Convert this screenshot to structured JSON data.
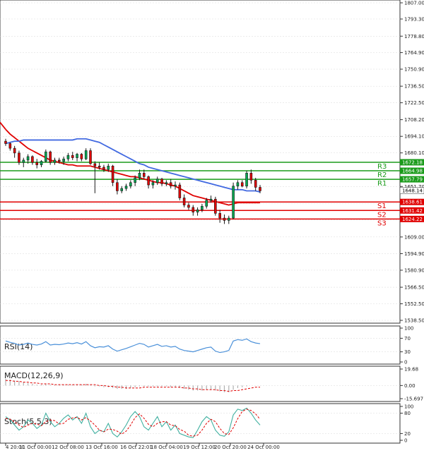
{
  "colors": {
    "background": "#ffffff",
    "grid": "#d9d9d9",
    "axis": "#333333",
    "candle": "#1a1a1a",
    "bull": "#00a651",
    "bear": "#e00000",
    "ma_fast": "#e00000",
    "ma_slow": "#4169e1",
    "resistance": "#1a9b1a",
    "support": "#e00000",
    "rsi_line": "#4a90d9",
    "macd_hist": "#b0b0b0",
    "macd_signal": "#e00000",
    "stoch_main": "#40b0a0",
    "stoch_signal": "#e00000"
  },
  "price_axis": {
    "ticks": [
      "1807.00",
      "1793.30",
      "1778.80",
      "1764.90",
      "1750.90",
      "1736.50",
      "1722.50",
      "1708.20",
      "1694.10",
      "1680.10",
      "1651.70",
      "1637.40",
      "1623.30",
      "1609.00",
      "1594.90",
      "1580.90",
      "1566.50",
      "1552.50",
      "1538.50"
    ]
  },
  "level_tags": [
    {
      "label": "R3",
      "value": "1672.18",
      "kind": "resistance"
    },
    {
      "label": "R2",
      "value": "1664.98",
      "kind": "resistance"
    },
    {
      "label": "R1",
      "value": "1657.79",
      "kind": "resistance"
    },
    {
      "label": "",
      "value": "1648.14",
      "kind": "current"
    },
    {
      "label": "S1",
      "value": "1638.61",
      "kind": "support"
    },
    {
      "label": "S2",
      "value": "1631.42",
      "kind": "support"
    },
    {
      "label": "S3",
      "value": "1624.22",
      "kind": "support"
    }
  ],
  "time_axis": {
    "labels": [
      "4 20:00",
      "11 Oct 00:00",
      "12 Oct 08:00",
      "13 Oct 16:00",
      "16 Oct 22:01",
      "18 Oct 04:00",
      "19 Oct 12:00",
      "20 Oct 20:00",
      "24 Oct 00:00"
    ]
  },
  "indicators": {
    "rsi": {
      "title": "RSI(14)",
      "ticks": [
        "100",
        "70",
        "30",
        "0"
      ]
    },
    "macd": {
      "title": "MACD(12,26,9)",
      "ticks": [
        "19.68",
        "0.00",
        "-15.697"
      ]
    },
    "stoch": {
      "title": "Stoch(5,5,3)",
      "ticks": [
        "100",
        "80",
        "20",
        "0"
      ]
    }
  },
  "chart_data": {
    "type": "candlestick",
    "y_range": [
      1538.5,
      1807.0
    ],
    "candles": [
      [
        1690,
        1692,
        1686,
        1688
      ],
      [
        1688,
        1689,
        1682,
        1684
      ],
      [
        1684,
        1686,
        1676,
        1680
      ],
      [
        1680,
        1682,
        1670,
        1672
      ],
      [
        1672,
        1676,
        1668,
        1674
      ],
      [
        1674,
        1679,
        1671,
        1677
      ],
      [
        1677,
        1678,
        1670,
        1672
      ],
      [
        1672,
        1675,
        1667,
        1670
      ],
      [
        1670,
        1674,
        1668,
        1673
      ],
      [
        1673,
        1683,
        1672,
        1681
      ],
      [
        1681,
        1682,
        1670,
        1672
      ],
      [
        1672,
        1676,
        1670,
        1674
      ],
      [
        1674,
        1676,
        1671,
        1673
      ],
      [
        1673,
        1677,
        1670,
        1675
      ],
      [
        1675,
        1680,
        1673,
        1678
      ],
      [
        1678,
        1681,
        1674,
        1676
      ],
      [
        1676,
        1680,
        1673,
        1679
      ],
      [
        1679,
        1680,
        1673,
        1675
      ],
      [
        1675,
        1684,
        1674,
        1682
      ],
      [
        1682,
        1684,
        1670,
        1671
      ],
      [
        1671,
        1673,
        1646,
        1669
      ],
      [
        1669,
        1672,
        1666,
        1668
      ],
      [
        1668,
        1670,
        1664,
        1666
      ],
      [
        1666,
        1671,
        1664,
        1669
      ],
      [
        1669,
        1670,
        1652,
        1655
      ],
      [
        1655,
        1658,
        1645,
        1648
      ],
      [
        1648,
        1652,
        1646,
        1650
      ],
      [
        1650,
        1654,
        1648,
        1652
      ],
      [
        1652,
        1657,
        1650,
        1655
      ],
      [
        1655,
        1661,
        1652,
        1659
      ],
      [
        1659,
        1666,
        1657,
        1663
      ],
      [
        1663,
        1666,
        1658,
        1660
      ],
      [
        1660,
        1661,
        1650,
        1653
      ],
      [
        1653,
        1657,
        1650,
        1655
      ],
      [
        1655,
        1660,
        1653,
        1658
      ],
      [
        1658,
        1659,
        1652,
        1654
      ],
      [
        1654,
        1657,
        1652,
        1655
      ],
      [
        1655,
        1658,
        1650,
        1652
      ],
      [
        1652,
        1656,
        1649,
        1653
      ],
      [
        1653,
        1655,
        1640,
        1642
      ],
      [
        1642,
        1645,
        1634,
        1636
      ],
      [
        1636,
        1638,
        1632,
        1634
      ],
      [
        1634,
        1636,
        1627,
        1630
      ],
      [
        1630,
        1634,
        1627,
        1632
      ],
      [
        1632,
        1637,
        1630,
        1635
      ],
      [
        1635,
        1642,
        1633,
        1640
      ],
      [
        1640,
        1644,
        1638,
        1641
      ],
      [
        1641,
        1643,
        1627,
        1629
      ],
      [
        1629,
        1632,
        1621,
        1625
      ],
      [
        1625,
        1628,
        1620,
        1623
      ],
      [
        1623,
        1627,
        1620,
        1625
      ],
      [
        1625,
        1655,
        1624,
        1652
      ],
      [
        1652,
        1657,
        1649,
        1655
      ],
      [
        1655,
        1657,
        1651,
        1652
      ],
      [
        1652,
        1665,
        1650,
        1663
      ],
      [
        1663,
        1666,
        1654,
        1657
      ],
      [
        1657,
        1659,
        1648,
        1651
      ],
      [
        1651,
        1653,
        1646,
        1648
      ]
    ],
    "ma_fast": [
      1700,
      1696,
      1693,
      1690,
      1687,
      1684,
      1682,
      1680,
      1678,
      1676,
      1674,
      1673,
      1672,
      1671,
      1670,
      1670,
      1669,
      1669,
      1669,
      1669,
      1668,
      1667,
      1666,
      1665,
      1664,
      1663,
      1662,
      1661,
      1660,
      1660,
      1659,
      1658,
      1657,
      1656,
      1655,
      1655,
      1654,
      1653,
      1652,
      1650,
      1648,
      1646,
      1644,
      1643,
      1642,
      1641,
      1640,
      1639,
      1638,
      1637,
      1636,
      1637,
      1638,
      1638,
      1638,
      1638,
      1638,
      1638
    ],
    "ma_slow": [
      1688,
      1689,
      1690,
      1690,
      1691,
      1691,
      1691,
      1691,
      1691,
      1691,
      1691,
      1691,
      1691,
      1691,
      1691,
      1691,
      1692,
      1692,
      1692,
      1691,
      1690,
      1689,
      1687,
      1685,
      1683,
      1681,
      1679,
      1677,
      1675,
      1673,
      1671,
      1670,
      1668,
      1667,
      1666,
      1665,
      1664,
      1663,
      1662,
      1661,
      1660,
      1659,
      1658,
      1657,
      1656,
      1655,
      1654,
      1653,
      1652,
      1651,
      1650,
      1649,
      1649,
      1649,
      1648,
      1648,
      1648,
      1647
    ],
    "rsi": [
      62,
      58,
      55,
      50,
      52,
      56,
      52,
      50,
      53,
      60,
      50,
      52,
      51,
      53,
      56,
      54,
      57,
      53,
      60,
      48,
      42,
      45,
      44,
      48,
      38,
      32,
      36,
      40,
      45,
      50,
      55,
      52,
      44,
      48,
      52,
      46,
      48,
      44,
      46,
      38,
      34,
      32,
      30,
      34,
      38,
      42,
      44,
      32,
      28,
      30,
      34,
      62,
      66,
      64,
      68,
      60,
      56,
      54
    ],
    "macd": [
      8,
      7,
      6,
      5,
      4,
      3,
      2,
      1,
      1,
      2,
      1,
      1,
      1,
      1,
      1,
      1,
      1,
      1,
      2,
      1,
      -1,
      -1,
      -2,
      -2,
      -3,
      -4,
      -4,
      -4,
      -3,
      -2,
      -1,
      -1,
      -1,
      -1,
      -1,
      -1,
      -1,
      -2,
      -2,
      -3,
      -4,
      -5,
      -6,
      -6,
      -6,
      -5,
      -5,
      -6,
      -7,
      -8,
      -8,
      -5,
      -3,
      -2,
      -1,
      0,
      0,
      0
    ],
    "macd_signal": [
      6,
      6,
      5,
      5,
      4,
      4,
      3,
      3,
      2,
      2,
      2,
      1,
      1,
      1,
      1,
      1,
      1,
      1,
      1,
      1,
      1,
      0,
      0,
      -1,
      -1,
      -2,
      -2,
      -3,
      -3,
      -3,
      -3,
      -2,
      -2,
      -2,
      -2,
      -2,
      -2,
      -2,
      -2,
      -2,
      -3,
      -3,
      -4,
      -4,
      -5,
      -5,
      -5,
      -5,
      -6,
      -6,
      -7,
      -6,
      -6,
      -5,
      -4,
      -3,
      -2,
      -2
    ],
    "stoch_main": [
      70,
      60,
      45,
      30,
      40,
      60,
      50,
      35,
      45,
      80,
      55,
      40,
      50,
      65,
      75,
      60,
      70,
      50,
      80,
      40,
      20,
      30,
      25,
      50,
      20,
      10,
      25,
      45,
      70,
      85,
      70,
      40,
      30,
      50,
      70,
      40,
      55,
      30,
      45,
      20,
      15,
      10,
      8,
      30,
      55,
      70,
      60,
      30,
      15,
      12,
      25,
      75,
      92,
      88,
      95,
      80,
      60,
      45
    ],
    "stoch_signal": [
      65,
      62,
      55,
      45,
      38,
      45,
      50,
      48,
      43,
      55,
      60,
      58,
      48,
      50,
      62,
      66,
      68,
      60,
      67,
      57,
      45,
      30,
      25,
      33,
      32,
      27,
      18,
      27,
      45,
      67,
      78,
      65,
      47,
      40,
      50,
      55,
      55,
      45,
      43,
      32,
      27,
      15,
      12,
      15,
      30,
      50,
      62,
      55,
      35,
      20,
      17,
      37,
      64,
      85,
      92,
      88,
      78,
      62
    ]
  }
}
